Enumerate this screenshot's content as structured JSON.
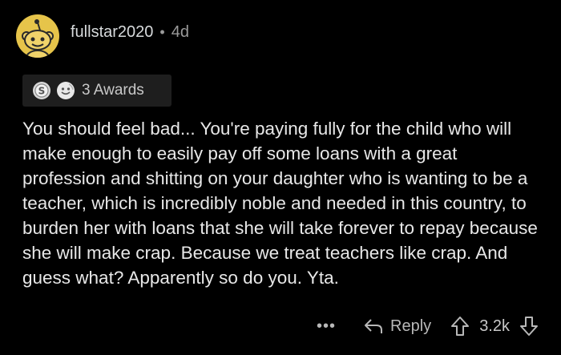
{
  "comment": {
    "username": "fullstar2020",
    "separator": "•",
    "age": "4d",
    "awards_label": "3 Awards",
    "body": "You should feel bad... You're paying fully for the child who will make enough to easily pay off some loans with a great profession and shitting on your daughter who is wanting to be a teacher, which is incredibly noble and needed in this country, to burden her with loans that she will take forever to repay because she will make crap. Because we treat teachers like crap. And guess what? Apparently so do you. Yta.",
    "more_label": "•••",
    "reply_label": "Reply",
    "score": "3.2k"
  },
  "colors": {
    "avatar_bg": "#e6c44a",
    "background": "#000000",
    "award_pill_bg": "#1e1e1e"
  },
  "icons": {
    "avatar": "snoo-avatar-icon",
    "award_1": "silver-award-icon",
    "award_2": "wholesome-award-icon",
    "reply": "reply-arrow-icon",
    "upvote": "upvote-arrow-icon",
    "downvote": "downvote-arrow-icon"
  }
}
